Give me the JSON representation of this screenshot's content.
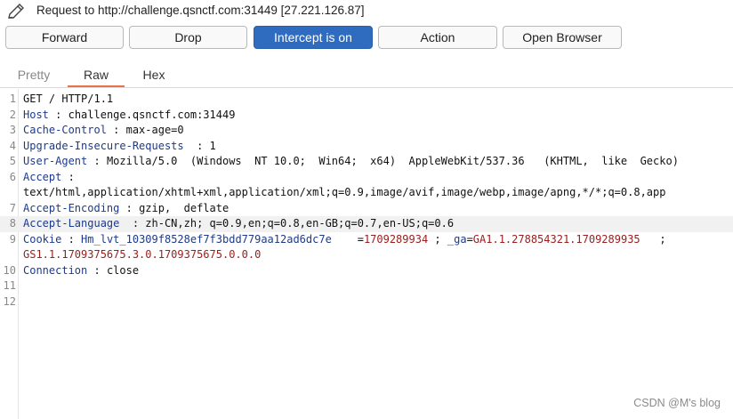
{
  "window": {
    "title": "Request to http://challenge.qsnctf.com:31449  [27.221.126.87]",
    "icon": "pencil-icon"
  },
  "toolbar": {
    "forward": "Forward",
    "drop": "Drop",
    "intercept": "Intercept is on",
    "action": "Action",
    "open_browser": "Open Browser"
  },
  "tabs": {
    "pretty": "Pretty",
    "raw": "Raw",
    "hex": "Hex",
    "selected": "Raw"
  },
  "request": {
    "lines": [
      {
        "num": "1",
        "text": "GET / HTTP/1.1"
      },
      {
        "num": "2",
        "key": "Host",
        "sep": " : ",
        "value": "challenge.qsnctf.com:31449"
      },
      {
        "num": "3",
        "key": "Cache-Control",
        "sep": " : ",
        "value": "max-age=0"
      },
      {
        "num": "4",
        "key": "Upgrade-Insecure-Requests",
        "sep": "  : ",
        "value": "1"
      },
      {
        "num": "5",
        "key": "User-Agent",
        "sep": " : ",
        "value": "Mozilla/5.0  (Windows  NT 10.0;  Win64;  x64)  AppleWebKit/537.36   (KHTML,  like  Gecko)"
      },
      {
        "num": "6",
        "key": "Accept",
        "sep": " :",
        "value": ""
      },
      {
        "num": "",
        "text": "text/html,application/xhtml+xml,application/xml;q=0.9,image/avif,image/webp,image/apng,*/*;q=0.8,app"
      },
      {
        "num": "7",
        "key": "Accept-Encoding",
        "sep": " : ",
        "value": "gzip,  deflate"
      },
      {
        "num": "8",
        "key": "Accept-Language",
        "sep": "  : ",
        "value": "zh-CN,zh; q=0.9,en;q=0.8,en-GB;q=0.7,en-US;q=0.6"
      },
      {
        "num": "9",
        "key": "Cookie",
        "sep": " : ",
        "cookie_name": "Hm_lvt_10309f8528ef7f3bdd779aa12ad6dc7e",
        "cookie_eq": "    =",
        "cookie_val": "1709289934",
        "cookie_sep": " ; ",
        "cookie2_name": "_ga",
        "cookie2_eq": "=",
        "cookie2_val": "GA1.1.278854321.1709289935",
        "cookie_tail": "   ;"
      },
      {
        "num": "",
        "cont": "GS1.1.1709375675.3.0.1709375675.0.0.0"
      },
      {
        "num": "10",
        "key": "Connection",
        "sep": " : ",
        "value": "close"
      },
      {
        "num": "11",
        "text": ""
      },
      {
        "num": "12",
        "text": ""
      }
    ]
  },
  "watermark": "CSDN @M's blog",
  "colors": {
    "accent": "#2f6cc0",
    "tab_underline": "#e8734a",
    "header_key": "#1e3a8a",
    "cookie_value": "#9b1c1c"
  }
}
